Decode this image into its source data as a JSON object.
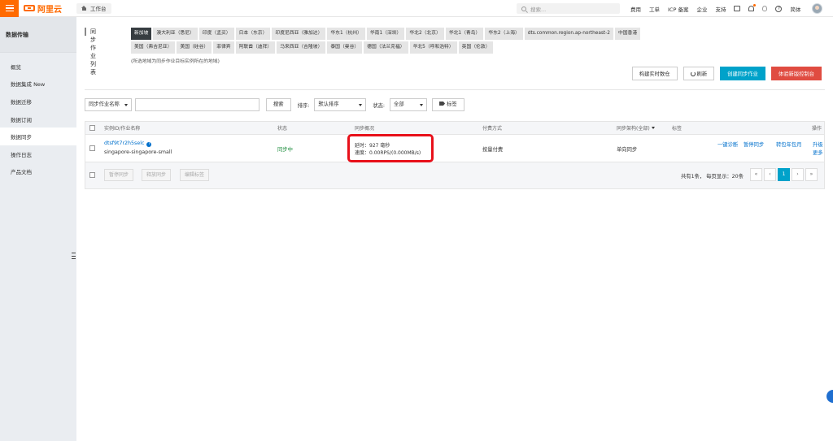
{
  "topbar": {
    "logo_text": "阿里云",
    "workbench_label": "工作台",
    "search_placeholder": "搜索...",
    "nav_items": [
      "费用",
      "工单",
      "ICP 备案",
      "企业",
      "支持"
    ],
    "language_label": "简体",
    "accent_color": "#ff6a00"
  },
  "sidebar": {
    "title": "数据传输",
    "items": [
      {
        "label": "概览"
      },
      {
        "label": "数据集成  New"
      },
      {
        "label": "数据迁移"
      },
      {
        "label": "数据订阅"
      },
      {
        "label": "数据同步"
      },
      {
        "label": "操作日志"
      },
      {
        "label": "产品文档"
      }
    ],
    "active_item": "数据同步"
  },
  "main": {
    "list_title": "同步作业列表",
    "regions": [
      "新加坡",
      "澳大利亚（悉尼）",
      "印度（孟买）",
      "日本（东京）",
      "印度尼西亚（雅加达）",
      "华东1（杭州）",
      "华南1（深圳）",
      "华北2（北京）",
      "华北1（青岛）",
      "华东2（上海）",
      "dts.common.region.ap-northeast-2",
      "中国香港",
      "美国（弗吉尼亚）",
      "美国（硅谷）",
      "菲律宾",
      "阿联酋（迪拜）",
      "马来西亚（吉隆坡）",
      "泰国（曼谷）",
      "德国（法兰克福）",
      "华北5（呼和浩特）",
      "英国（伦敦）"
    ],
    "active_region": "新加坡",
    "region_note": "(所选地域为同步作业目标实例所在的地域)",
    "actions": {
      "build_realtime": "构建实时数仓",
      "refresh": "刷新",
      "create_job": "创建同步作业",
      "try_new_console": "体验新版控制台"
    },
    "filters": {
      "field_select": "同步作业名称",
      "search_value": "",
      "search_button": "搜索",
      "sort_label": "排序:",
      "sort_value": "默认排序",
      "status_label": "状态:",
      "status_value": "全部",
      "tag_button": "标签"
    },
    "table": {
      "headers": [
        "实例ID/作业名称",
        "状态",
        "同步概况",
        "付费方式",
        "同步架构(全部)",
        "标签",
        "操作"
      ],
      "rows": [
        {
          "instance_id": "dtsf9t7r2h5selc",
          "job_name": "singapore-singapore-small",
          "status": "同步中",
          "latency": "延时：927 毫秒",
          "speed": "速度：0.00RPS/(0.000MB/s)",
          "billing": "按量付费",
          "topology": "单向同步",
          "tags": "",
          "actions": [
            "一键诊断",
            "暂停同步",
            "转包年包月",
            "升级",
            "更多"
          ]
        }
      ],
      "footer_buttons": [
        "暂停同步",
        "释放同步",
        "编辑标签"
      ],
      "total_text": "共有1条，  每页显示：20条",
      "pagination": [
        "«",
        "‹",
        "1",
        "›",
        "»"
      ],
      "current_page": "1"
    }
  }
}
